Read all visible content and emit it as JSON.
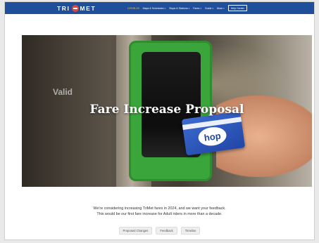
{
  "header": {
    "logo_left": "TRI",
    "logo_right": "MET",
    "nav": [
      {
        "label": "COVID-19"
      },
      {
        "label": "Maps & Schedules"
      },
      {
        "label": "Stops & Stations"
      },
      {
        "label": "Fares"
      },
      {
        "label": "Guide"
      },
      {
        "label": "More"
      }
    ],
    "help_label": "Help Center"
  },
  "hero": {
    "title": "Fare Increase Proposal",
    "reader_text": "Valid",
    "card_brand": "hop"
  },
  "intro": {
    "line1": "We're considering increasing TriMet fares in 2024, and we want your feedback.",
    "line2": "This would be our first fare increase for Adult riders in more than a decade."
  },
  "tabs": [
    {
      "label": "Proposed Changes"
    },
    {
      "label": "Feedback"
    },
    {
      "label": "Timeline"
    }
  ],
  "colors": {
    "nav_bg": "#1f4f9a",
    "covid_link": "#ffcc66",
    "reader_green": "#3aa53a",
    "card_blue": "#2146a6"
  },
  "icons": [
    "logo-mark-icon",
    "chevron-down-icon"
  ]
}
